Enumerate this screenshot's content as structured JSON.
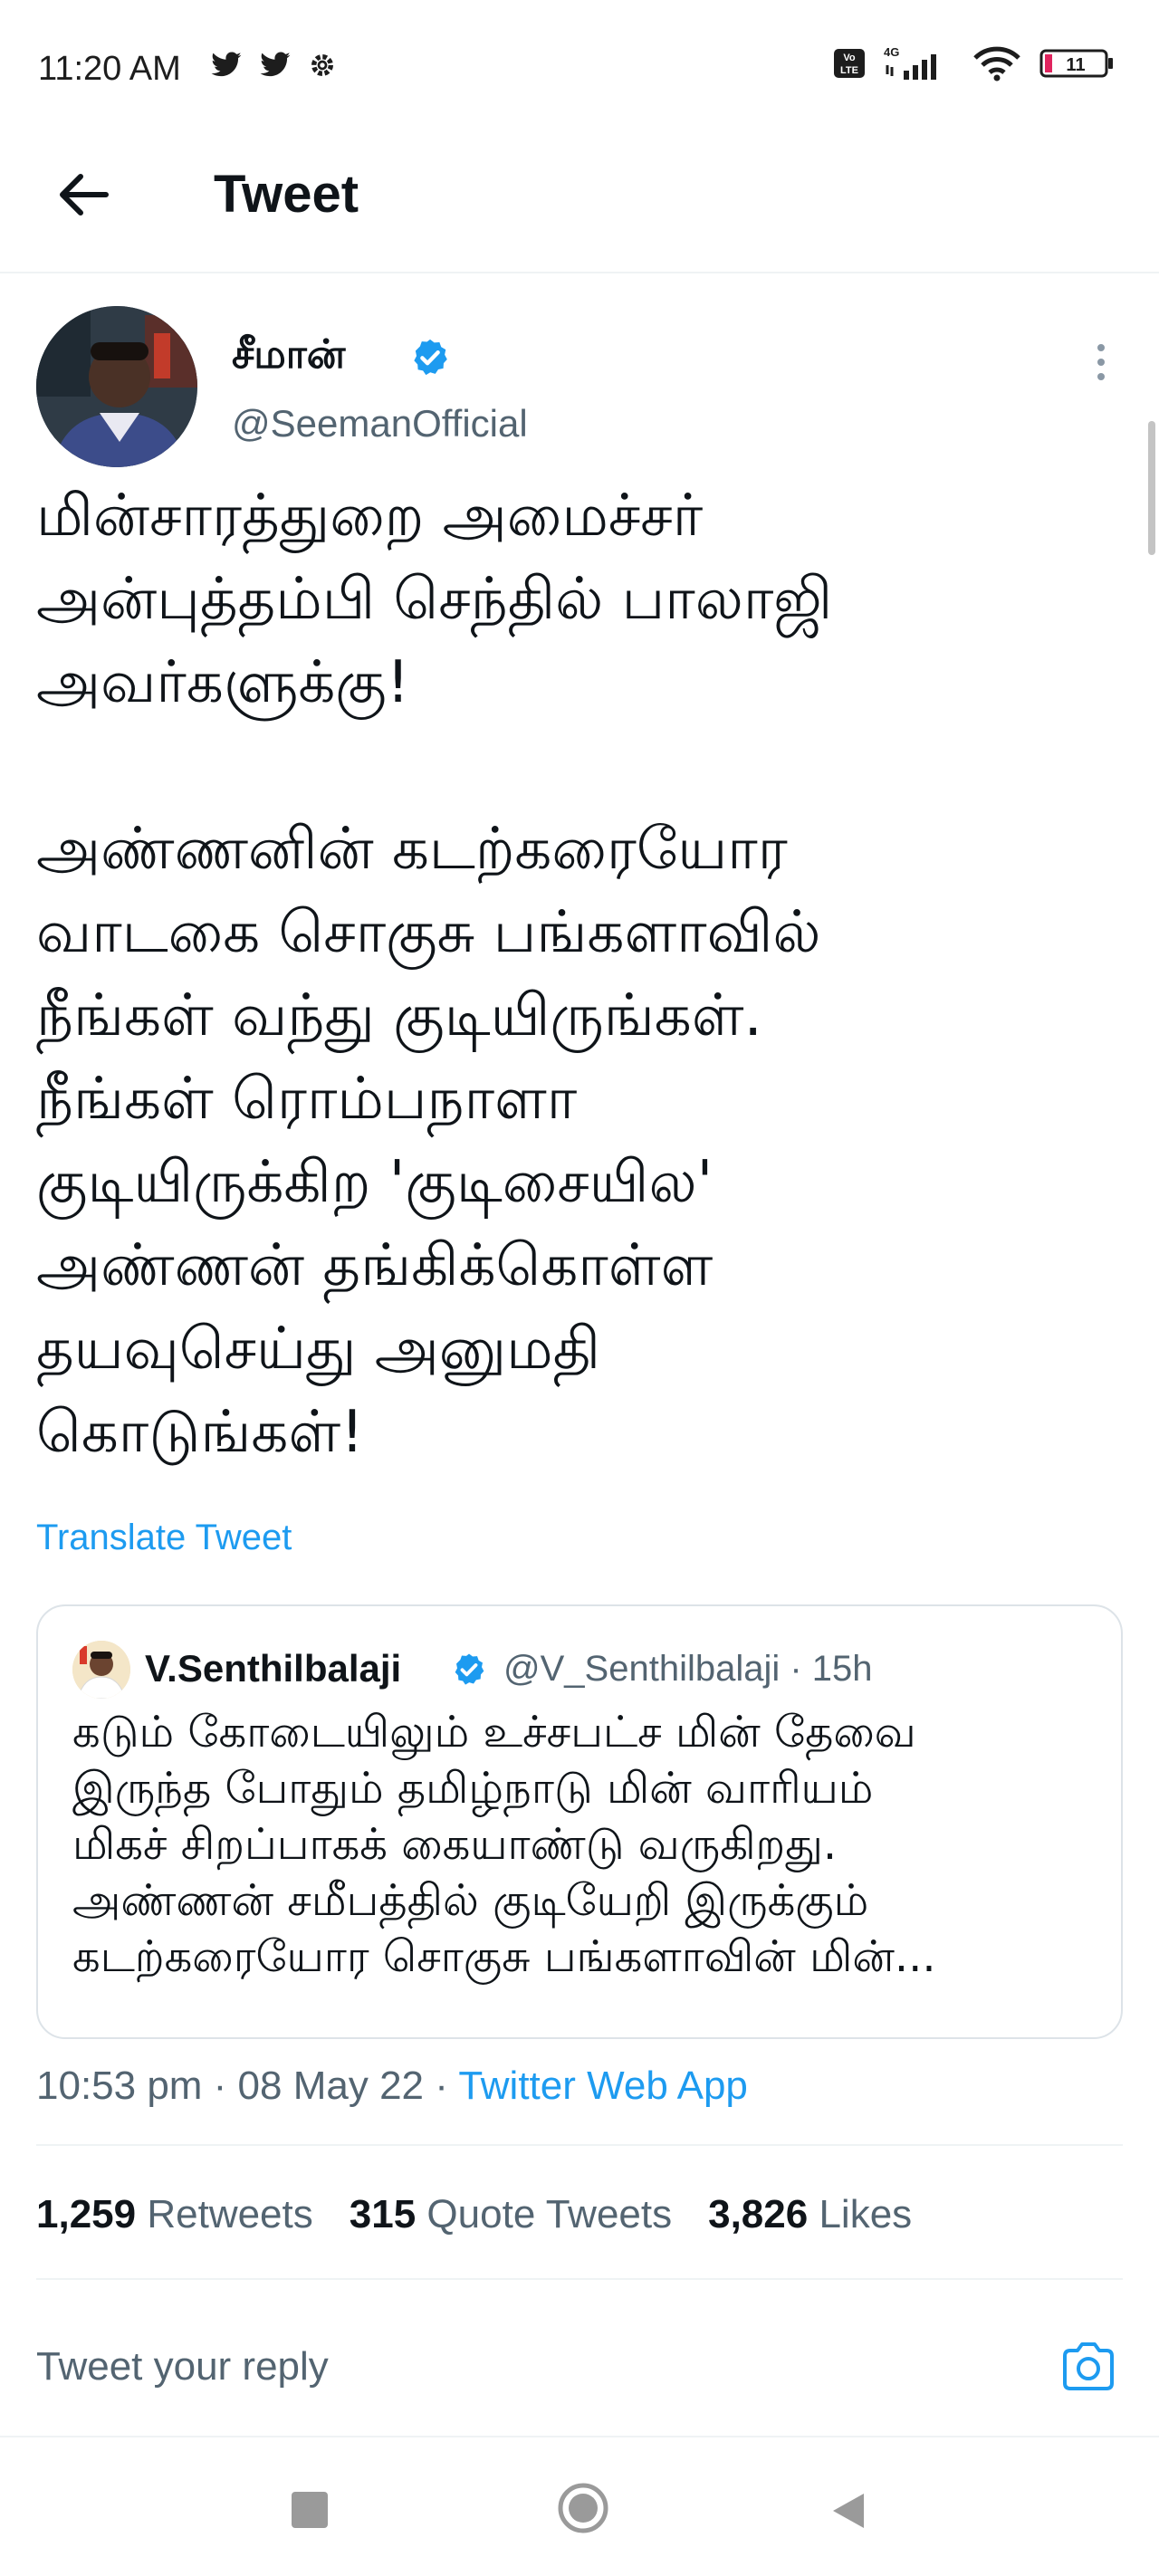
{
  "status_bar": {
    "time": "11:20 AM",
    "battery": "11",
    "network": "4G",
    "volte": "Vo LTE"
  },
  "header": {
    "title": "Tweet"
  },
  "author": {
    "name": "சீமான்",
    "handle": "@SeemanOfficial",
    "verified": true
  },
  "tweet": {
    "text": "மின்சாரத்துறை அமைச்சர்\nஅன்புத்தம்பி செந்தில் பாலாஜி\nஅவர்களுக்கு!\n\nஅண்ணனின் கடற்கரையோர\nவாடகை சொகுசு பங்களாவில்\nநீங்கள் வந்து குடியிருங்கள்.\nநீங்கள் ரொம்பநாளா\nகுடியிருக்கிற 'குடிசையில'\nஅண்ணன் தங்கிக்கொள்ள\nதயவுசெய்து அனுமதி\nகொடுங்கள்!",
    "translate_label": "Translate Tweet"
  },
  "quote": {
    "name": "V.Senthilbalaji",
    "handle": "@V_Senthilbalaji · 15h",
    "verified": true,
    "text": "கடும் கோடையிலும் உச்சபட்ச மின் தேவை\nஇருந்த போதும் தமிழ்நாடு மின் வாரியம்\nமிகச் சிறப்பாகக் கையாண்டு வருகிறது.\nஅண்ணன் சமீபத்தில் குடியேறி இருக்கும்\nகடற்கரையோர சொகுசு பங்களாவின் மின்..."
  },
  "meta": {
    "datetime": "10:53 pm · 08 May 22 · ",
    "source": "Twitter Web App"
  },
  "stats": {
    "retweets_count": "1,259",
    "retweets_label": "Retweets",
    "quotes_count": "315",
    "quotes_label": "Quote Tweets",
    "likes_count": "3,826",
    "likes_label": "Likes"
  },
  "reply": {
    "placeholder": "Tweet your reply"
  },
  "colors": {
    "accent": "#1d9bf0",
    "text": "#0f1419",
    "secondary": "#536471",
    "battery_low": "#e0245e"
  }
}
